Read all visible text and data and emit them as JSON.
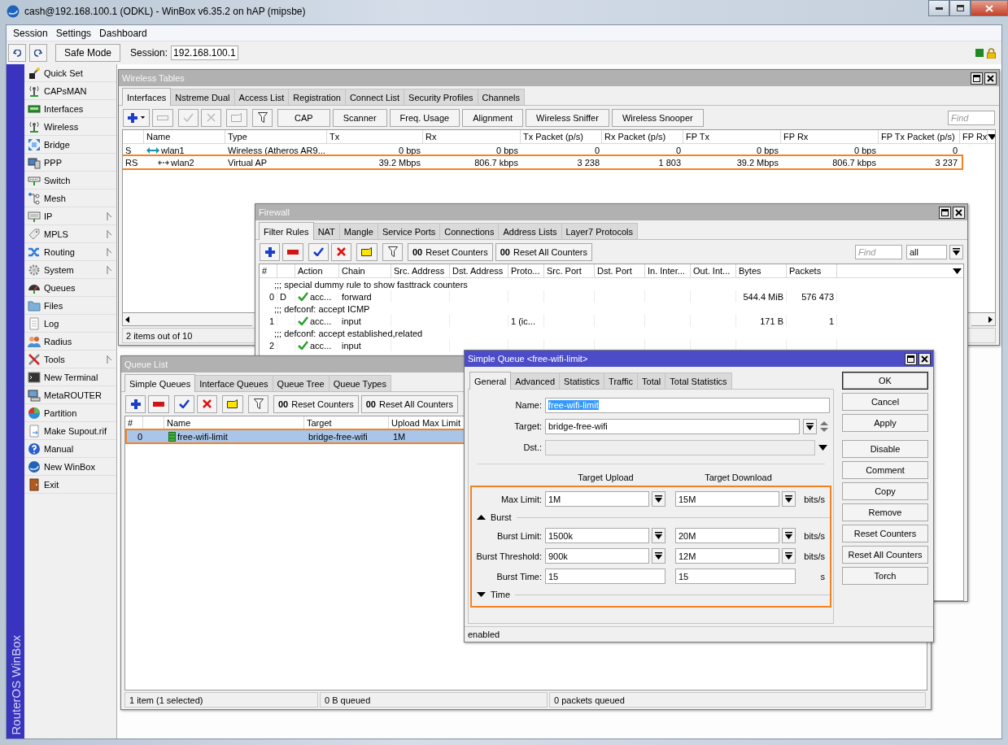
{
  "window": {
    "title": "cash@192.168.100.1 (ODKL) - WinBox v6.35.2 on hAP (mipsbe)"
  },
  "menu": [
    "Session",
    "Settings",
    "Dashboard"
  ],
  "toolbar": {
    "safe_mode": "Safe Mode",
    "session_label": "Session:",
    "session": "192.168.100.1"
  },
  "sidebar": {
    "brand": "RouterOS WinBox",
    "items": [
      {
        "label": "Quick Set",
        "submenu": false
      },
      {
        "label": "CAPsMAN",
        "submenu": false
      },
      {
        "label": "Interfaces",
        "submenu": false
      },
      {
        "label": "Wireless",
        "submenu": false
      },
      {
        "label": "Bridge",
        "submenu": false
      },
      {
        "label": "PPP",
        "submenu": false
      },
      {
        "label": "Switch",
        "submenu": false
      },
      {
        "label": "Mesh",
        "submenu": false
      },
      {
        "label": "IP",
        "submenu": true
      },
      {
        "label": "MPLS",
        "submenu": true
      },
      {
        "label": "Routing",
        "submenu": true
      },
      {
        "label": "System",
        "submenu": true
      },
      {
        "label": "Queues",
        "submenu": false
      },
      {
        "label": "Files",
        "submenu": false
      },
      {
        "label": "Log",
        "submenu": false
      },
      {
        "label": "Radius",
        "submenu": false
      },
      {
        "label": "Tools",
        "submenu": true
      },
      {
        "label": "New Terminal",
        "submenu": false
      },
      {
        "label": "MetaROUTER",
        "submenu": false
      },
      {
        "label": "Partition",
        "submenu": false
      },
      {
        "label": "Make Supout.rif",
        "submenu": false
      },
      {
        "label": "Manual",
        "submenu": false
      },
      {
        "label": "New WinBox",
        "submenu": false
      },
      {
        "label": "Exit",
        "submenu": false
      }
    ]
  },
  "wireless": {
    "title": "Wireless Tables",
    "active": false,
    "tabs": [
      {
        "label": "Interfaces",
        "selected": true
      },
      {
        "label": "Nstreme Dual",
        "selected": false
      },
      {
        "label": "Access List",
        "selected": false
      },
      {
        "label": "Registration",
        "selected": false
      },
      {
        "label": "Connect List",
        "selected": false
      },
      {
        "label": "Security Profiles",
        "selected": false
      },
      {
        "label": "Channels",
        "selected": false
      }
    ],
    "edit_tools_enabled": false,
    "buttons": [
      "CAP",
      "Scanner",
      "Freq. Usage",
      "Alignment",
      "Wireless Sniffer",
      "Wireless Snooper"
    ],
    "find_placeholder": "Find",
    "columns": [
      "Name",
      "Type",
      "Tx",
      "Rx",
      "Tx Packet (p/s)",
      "Rx Packet (p/s)",
      "FP Tx",
      "FP Rx",
      "FP Tx Packet (p/s)",
      "FP Rx"
    ],
    "rows": [
      {
        "flags": "S",
        "name": "wlan1",
        "type": "Wireless (Atheros AR9...",
        "tx": "0 bps",
        "rx": "0 bps",
        "tx_packet": "0",
        "rx_packet": "0",
        "fp_tx": "0 bps",
        "fp_rx": "0 bps",
        "fp_tx_packet": "0",
        "highlighted": false,
        "children": [
          {
            "flags": "RS",
            "name": "wlan2",
            "type": "Virtual AP",
            "tx": "39.2 Mbps",
            "rx": "806.7 kbps",
            "tx_packet": "3 238",
            "rx_packet": "1 803",
            "fp_tx": "39.2 Mbps",
            "fp_rx": "806.7 kbps",
            "fp_tx_packet": "3 237",
            "highlighted": true
          }
        ]
      }
    ],
    "status": "2 items out of 10"
  },
  "firewall": {
    "title": "Firewall",
    "active": false,
    "tabs": [
      {
        "label": "Filter Rules",
        "selected": true
      },
      {
        "label": "NAT",
        "selected": false
      },
      {
        "label": "Mangle",
        "selected": false
      },
      {
        "label": "Service Ports",
        "selected": false
      },
      {
        "label": "Connections",
        "selected": false
      },
      {
        "label": "Address Lists",
        "selected": false
      },
      {
        "label": "Layer7 Protocols",
        "selected": false
      }
    ],
    "edit_tools_enabled": true,
    "buttons": [
      {
        "icon_text": "00",
        "label": "Reset Counters"
      },
      {
        "icon_text": "00",
        "label": "Reset All Counters"
      }
    ],
    "find_placeholder": "Find",
    "filter": "all",
    "columns": [
      "#",
      "Action",
      "Chain",
      "Src. Address",
      "Dst. Address",
      "Proto...",
      "Src. Port",
      "Dst. Port",
      "In. Inter...",
      "Out. Int...",
      "Bytes",
      "Packets"
    ],
    "rows": [
      {
        "kind": "comment",
        "text": ";;; special dummy rule to show fasttrack counters"
      },
      {
        "kind": "rule",
        "number": "0",
        "flag": "D",
        "action": "acc...",
        "chain": "forward",
        "bytes": "544.4 MiB",
        "packets": "576 473"
      },
      {
        "kind": "comment",
        "text": ";;; defconf: accept ICMP"
      },
      {
        "kind": "rule",
        "number": "1",
        "action": "acc...",
        "chain": "input",
        "protocol": "1 (ic...",
        "bytes": "171 B",
        "packets": "1"
      },
      {
        "kind": "comment",
        "text": ";;; defconf: accept established,related"
      },
      {
        "kind": "rule",
        "number": "2",
        "action": "acc...",
        "chain": "input"
      }
    ]
  },
  "queue_list": {
    "title": "Queue List",
    "active": false,
    "tabs": [
      {
        "label": "Simple Queues",
        "selected": true
      },
      {
        "label": "Interface Queues",
        "selected": false
      },
      {
        "label": "Queue Tree",
        "selected": false
      },
      {
        "label": "Queue Types",
        "selected": false
      }
    ],
    "edit_tools_enabled": true,
    "buttons": [
      {
        "icon_text": "00",
        "label": "Reset Counters"
      },
      {
        "icon_text": "00",
        "label": "Reset All Counters"
      }
    ],
    "columns": [
      "#",
      "Name",
      "Target",
      "Upload Max Limit"
    ],
    "rows": [
      {
        "number": "0",
        "name": "free-wifi-limit",
        "target": "bridge-free-wifi",
        "upload_max_limit": "1M",
        "selected": true,
        "highlighted": true
      }
    ],
    "status": [
      "1 item (1 selected)",
      "0 B queued",
      "0 packets queued"
    ]
  },
  "simple_queue": {
    "title": "Simple Queue <free-wifi-limit>",
    "active": true,
    "tabs": [
      {
        "label": "General",
        "selected": true
      },
      {
        "label": "Advanced",
        "selected": false
      },
      {
        "label": "Statistics",
        "selected": false
      },
      {
        "label": "Traffic",
        "selected": false
      },
      {
        "label": "Total",
        "selected": false
      },
      {
        "label": "Total Statistics",
        "selected": false
      }
    ],
    "name": {
      "label": "Name:",
      "value": "free-wifi-limit",
      "selected_text": true
    },
    "target": {
      "label": "Target:",
      "value": "bridge-free-wifi"
    },
    "dst": {
      "label": "Dst.:",
      "disabled": true
    },
    "column_headers": [
      "Target Upload",
      "Target Download"
    ],
    "limits": {
      "highlighted": true,
      "items": [
        {
          "kind": "row",
          "label": "Max Limit:",
          "upload": "1M",
          "download": "15M",
          "unit": "bits/s",
          "dropdown": true
        },
        {
          "kind": "section",
          "label": "Burst",
          "expanded": true
        },
        {
          "kind": "row",
          "label": "Burst Limit:",
          "upload": "1500k",
          "download": "20M",
          "unit": "bits/s",
          "dropdown": true
        },
        {
          "kind": "row",
          "label": "Burst Threshold:",
          "upload": "900k",
          "download": "12M",
          "unit": "bits/s",
          "dropdown": true
        },
        {
          "kind": "row",
          "label": "Burst Time:",
          "upload": "15",
          "download": "15",
          "unit": "s",
          "dropdown": false
        },
        {
          "kind": "section",
          "label": "Time",
          "expanded": false
        }
      ]
    },
    "button_groups": [
      [
        {
          "label": "OK",
          "default": true
        },
        {
          "label": "Cancel",
          "default": false
        },
        {
          "label": "Apply",
          "default": false
        }
      ],
      [
        {
          "label": "Disable",
          "default": false
        },
        {
          "label": "Comment",
          "default": false
        },
        {
          "label": "Copy",
          "default": false
        },
        {
          "label": "Remove",
          "default": false
        },
        {
          "label": "Reset Counters",
          "default": false
        },
        {
          "label": "Reset All Counters",
          "default": false
        },
        {
          "label": "Torch",
          "default": false
        }
      ]
    ],
    "status": "enabled"
  }
}
